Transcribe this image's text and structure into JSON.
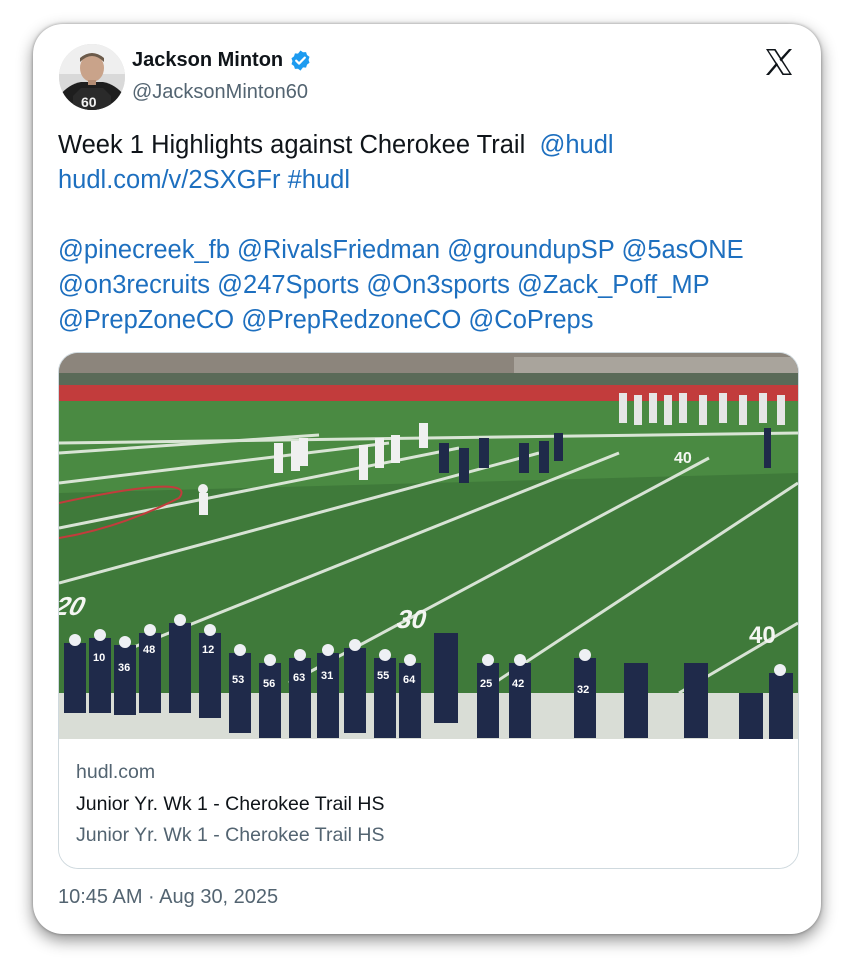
{
  "author": {
    "name": "Jackson Minton",
    "handle": "@JacksonMinton60",
    "avatar_icon": "football-player-avatar",
    "verified_icon": "verified-badge-icon",
    "verified_color": "#1d9bf0"
  },
  "brand_icon": "x-logo-icon",
  "tweet": {
    "line1_text": "Week 1 Highlights against Cherokee Trail",
    "line1_mention": "@hudl",
    "line2_link": "hudl.com/v/2SXGFr",
    "line2_hashtag": "#hudl",
    "mentions_line1": [
      "@pinecreek_fb",
      "@RivalsFriedman",
      "@groundupSP",
      "@5asONE"
    ],
    "mentions_line2": [
      "@on3recruits",
      "@247Sports",
      "@On3sports",
      "@Zack_Poff_MP"
    ],
    "mentions_line3": [
      "@PrepZoneCO",
      "@PrepRedzoneCO",
      "@CoPreps"
    ]
  },
  "card": {
    "domain": "hudl.com",
    "title": "Junior Yr. Wk 1 - Cherokee Trail HS",
    "description": "Junior Yr. Wk 1 - Cherokee Trail HS",
    "image": {
      "field_numbers": [
        "20",
        "30",
        "40",
        "40"
      ],
      "jersey_numbers": [
        "10",
        "36",
        "48",
        "12",
        "53",
        "56",
        "63",
        "31",
        "55",
        "64",
        "25",
        "42",
        "32"
      ]
    }
  },
  "timestamp": "10:45 AM · Aug 30, 2025",
  "colors": {
    "link": "#1d6fbf",
    "field_green": "#3f7a3a",
    "team_navy": "#1f2a4a"
  }
}
